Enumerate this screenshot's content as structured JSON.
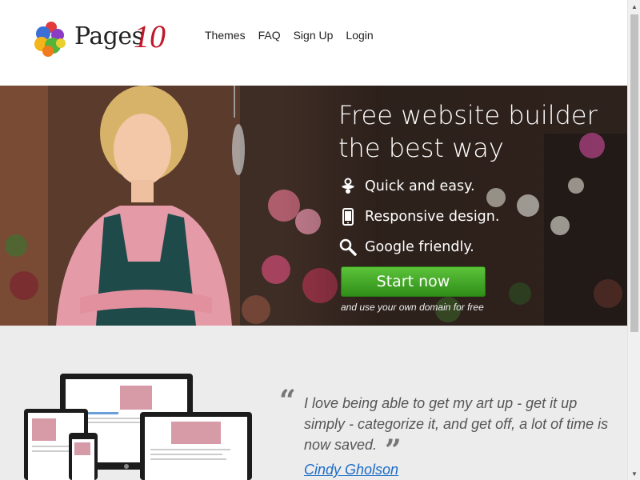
{
  "header": {
    "logo_text": "Pages",
    "logo_number": "10",
    "nav": [
      "Themes",
      "FAQ",
      "Sign Up",
      "Login"
    ]
  },
  "hero": {
    "title_line1": "Free website builder",
    "title_line2": "the best way",
    "features": [
      {
        "icon": "pacifier-icon",
        "label": "Quick and easy."
      },
      {
        "icon": "smartphone-icon",
        "label": "Responsive design."
      },
      {
        "icon": "magnifier-icon",
        "label": "Google friendly."
      }
    ],
    "cta_label": "Start now",
    "cta_note": "and use your own domain for free"
  },
  "testimonial": {
    "quote": "I love being able to get my art up - get it up simply - categorize it, and get off, a lot of time is now saved.",
    "author": "Cindy Gholson"
  },
  "colors": {
    "brand_red": "#c0182b",
    "cta_green": "#3ea524",
    "link_blue": "#1a6cc7"
  }
}
